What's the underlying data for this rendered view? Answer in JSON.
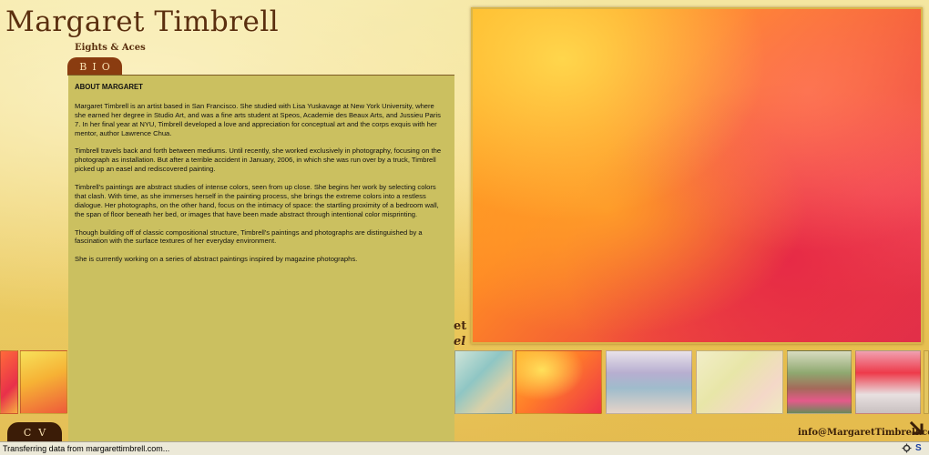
{
  "header": {
    "title": "Margaret Timbrell",
    "subtitle": "Eights & Aces"
  },
  "tabs": {
    "bio_label": "BIO",
    "cv_label": "CV"
  },
  "bio": {
    "heading": "ABOUT MARGARET",
    "paragraphs": [
      "Margaret Timbrell is an artist based in San Francisco. She studied with Lisa Yuskavage at New York University, where she earned her degree in Studio Art, and was a fine arts student at Speos, Academie des Beaux Arts, and Jussieu Paris 7. In her final year at NYU, Timbrell developed a love and appreciation for conceptual art and the corps exquis with her mentor, author Lawrence Chua.",
      "Timbrell travels back and forth between mediums. Until recently, she worked exclusively in photography, focusing on the photograph as installation.  But after a terrible accident in January, 2006, in which she was run over by a truck, Timbrell picked up an easel and rediscovered painting.",
      "Timbrell's paintings are abstract studies of intense colors, seen from up close. She begins her work by selecting colors that clash. With time, as she immerses herself in the painting process, she brings the extreme colors into a restless dialogue. Her photographs, on the other hand, focus on the intimacy of space: the startling proximity of a bedroom wall, the span of floor beneath her bed, or images that have been made abstract through intentional color misprinting.",
      "Though building off of classic compositional structure, Timbrell's paintings and photographs are distinguished by a fascination with the surface textures of her everyday environment.",
      "She is currently working on a series of abstract paintings inspired by magazine photographs."
    ]
  },
  "partially_hidden_text": {
    "line1": "et",
    "line2": "el"
  },
  "footer": {
    "email": "info@MargaretTimbrell.com"
  },
  "status_bar": {
    "text": "Transferring data from margarettimbrell.com..."
  },
  "colors": {
    "brown_dark": "#3b1c07",
    "brown_tab": "#8a3c10",
    "panel": "#cbc060",
    "title": "#5a2f0e"
  },
  "icons": {
    "arrow": "arrow-down-right-icon",
    "status_gear": "gear-icon",
    "status_s": "s-logo-icon"
  }
}
